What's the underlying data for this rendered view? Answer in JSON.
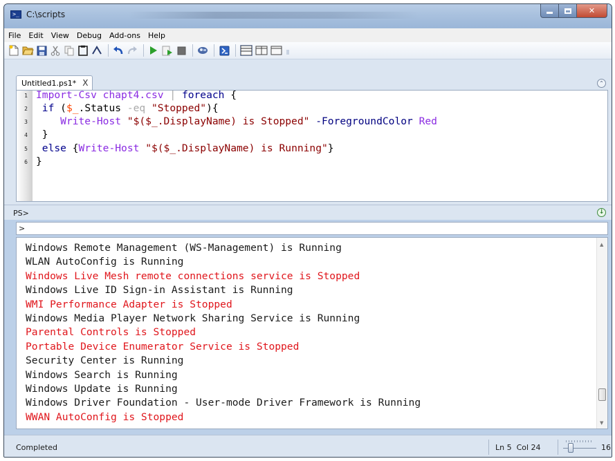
{
  "window": {
    "title": "C:\\scripts",
    "icon_text": ">_"
  },
  "menu": [
    "File",
    "Edit",
    "View",
    "Debug",
    "Add-ons",
    "Help"
  ],
  "toolbar": {
    "icons": [
      "new-icon",
      "open-icon",
      "save-icon",
      "cut-icon",
      "copy-icon",
      "paste-icon",
      "clear-icon",
      "undo-icon",
      "redo-icon",
      "run-icon",
      "run-selection-icon",
      "stop-icon",
      "new-remote-tab-icon",
      "powershell-icon",
      "layout-top-icon",
      "layout-right-icon",
      "layout-max-icon"
    ]
  },
  "editor": {
    "tab_label": "Untitled1.ps1*",
    "tab_close": "X",
    "line_numbers": [
      "1",
      "2",
      "3",
      "4",
      "5",
      "6"
    ]
  },
  "console": {
    "prompt_label": "PS>",
    "input_value": ">"
  },
  "output": {
    "lines": [
      {
        "text": "Windows Remote Management (WS-Management) is Running",
        "status": "running"
      },
      {
        "text": "WLAN AutoConfig is Running",
        "status": "running"
      },
      {
        "text": "Windows Live Mesh remote connections service is Stopped",
        "status": "stopped"
      },
      {
        "text": "Windows Live ID Sign-in Assistant is Running",
        "status": "running"
      },
      {
        "text": "WMI Performance Adapter is Stopped",
        "status": "stopped"
      },
      {
        "text": "Windows Media Player Network Sharing Service is Running",
        "status": "running"
      },
      {
        "text": "Parental Controls is Stopped",
        "status": "stopped"
      },
      {
        "text": "Portable Device Enumerator Service is Stopped",
        "status": "stopped"
      },
      {
        "text": "Security Center is Running",
        "status": "running"
      },
      {
        "text": "Windows Search is Running",
        "status": "running"
      },
      {
        "text": "Windows Update is Running",
        "status": "running"
      },
      {
        "text": "Windows Driver Foundation - User-mode Driver Framework is Running",
        "status": "running"
      },
      {
        "text": "WWAN AutoConfig is Stopped",
        "status": "stopped"
      }
    ]
  },
  "status": {
    "text": "Completed",
    "position": "Ln 5  Col 24",
    "zoom": "16"
  },
  "colors": {
    "stopped": "#e0161c",
    "running": "#1a1a1a",
    "chrome": "#dbe5f1"
  }
}
